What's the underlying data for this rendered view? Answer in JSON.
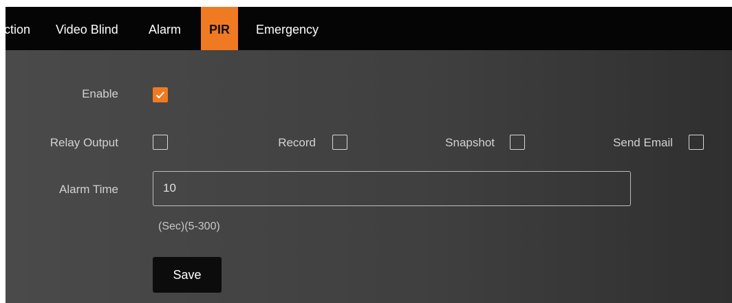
{
  "tabs": [
    {
      "label": "ction",
      "active": false
    },
    {
      "label": "Video Blind",
      "active": false
    },
    {
      "label": "Alarm",
      "active": false
    },
    {
      "label": "PIR",
      "active": true
    },
    {
      "label": "Emergency",
      "active": false
    }
  ],
  "form": {
    "enable_label": "Enable",
    "enable_checked": true,
    "relay_output_label": "Relay Output",
    "relay_output_checked": false,
    "record_label": "Record",
    "record_checked": false,
    "snapshot_label": "Snapshot",
    "snapshot_checked": false,
    "send_email_label": "Send Email",
    "send_email_checked": false,
    "alarm_time_label": "Alarm Time",
    "alarm_time_value": "10",
    "alarm_time_hint": "(Sec)(5-300)",
    "save_label": "Save"
  },
  "colors": {
    "accent": "#f07a22",
    "tabbar_bg": "#050505",
    "panel_bg": "#404040"
  },
  "icons": {
    "check": "check-icon"
  }
}
